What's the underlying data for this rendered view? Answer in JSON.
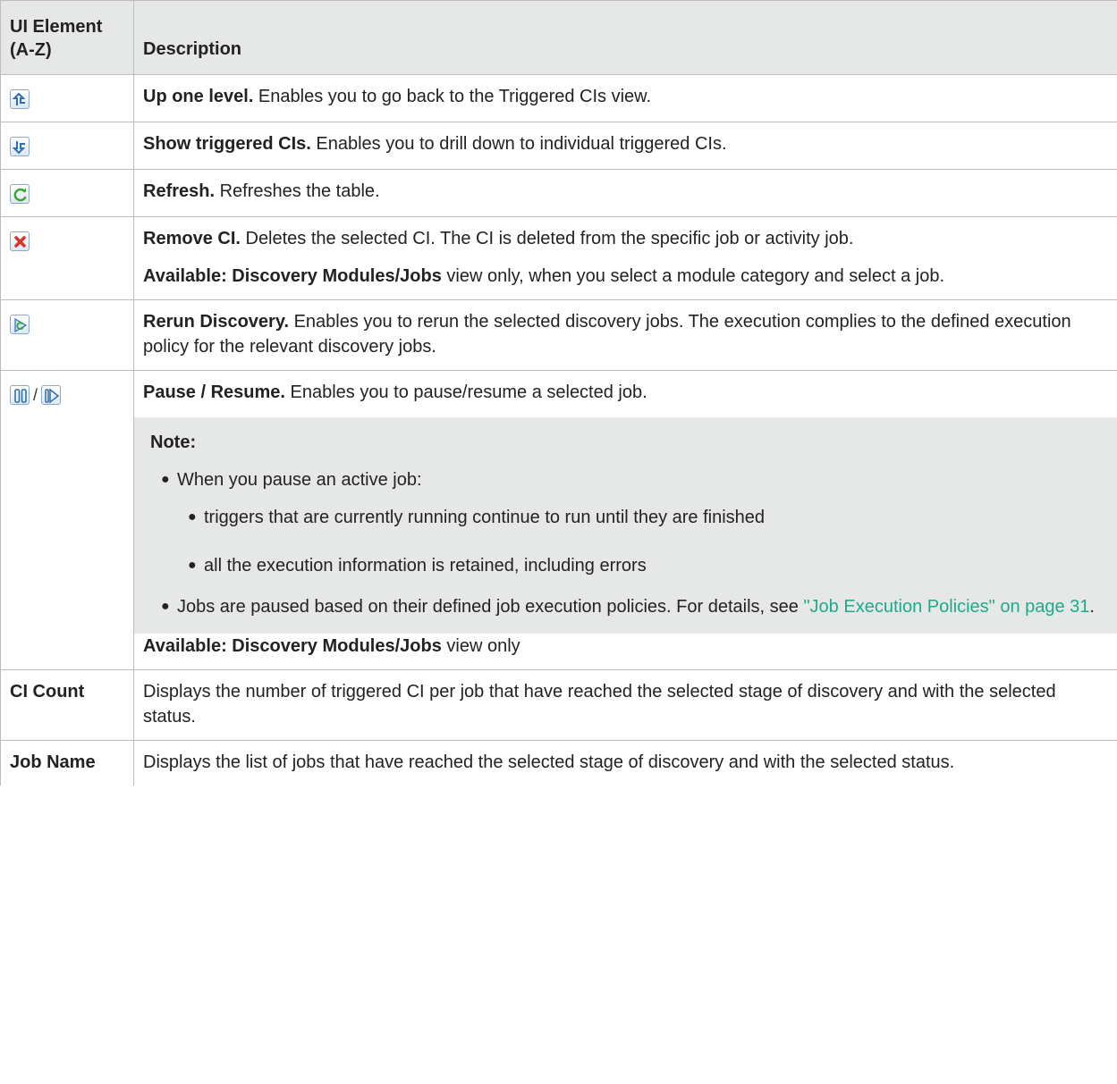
{
  "header": {
    "element_label": "UI Element (A-Z)",
    "description_label": "Description"
  },
  "rows": [
    {
      "icon": "up-one-level-icon",
      "title": "Up one level.",
      "text": " Enables you to go back to the Triggered CIs view."
    },
    {
      "icon": "show-triggered-cis-icon",
      "title": "Show triggered CIs.",
      "text": " Enables you to drill down to individual triggered CIs."
    },
    {
      "icon": "refresh-icon",
      "title": "Refresh.",
      "text": " Refreshes the table."
    },
    {
      "icon": "remove-ci-icon",
      "title": "Remove CI.",
      "text": " Deletes the selected CI. The CI is deleted from the specific job or activity job.",
      "available_bold": "Available: Discovery Modules/Jobs",
      "available_text": " view only, when you select a module category and select a job."
    },
    {
      "icon": "rerun-discovery-icon",
      "title": "Rerun Discovery.",
      "text": " Enables you to rerun the selected discovery jobs. The execution complies to the defined execution policy for the relevant discovery jobs."
    },
    {
      "icon_pause": "pause-icon",
      "separator": "/",
      "icon_resume": "resume-icon",
      "title": "Pause / Resume.",
      "text": " Enables you to pause/resume a selected job.",
      "note": {
        "title": "Note:",
        "item1": "When you pause an active job:",
        "sub1": "triggers that are currently running continue to run until they are finished",
        "sub2": "all the execution information is retained, including errors",
        "item2": "Jobs are paused based on their defined job execution policies. For details, see ",
        "item2_link": "\"Job Execution Policies\" on page 31",
        "item2_end": "."
      },
      "available_bold": "Available: Discovery Modules/Jobs",
      "available_text": " view only"
    },
    {
      "element": "CI Count",
      "text": "Displays the number of triggered CI per job that have reached the selected stage of discovery and with the selected status."
    },
    {
      "element": "Job Name",
      "text": "Displays the list of jobs that have reached the selected stage of discovery and with the selected status."
    }
  ],
  "colors": {
    "header_bg": "#e6e8e8",
    "link": "#1aac8c",
    "border": "#bdbdbd"
  }
}
